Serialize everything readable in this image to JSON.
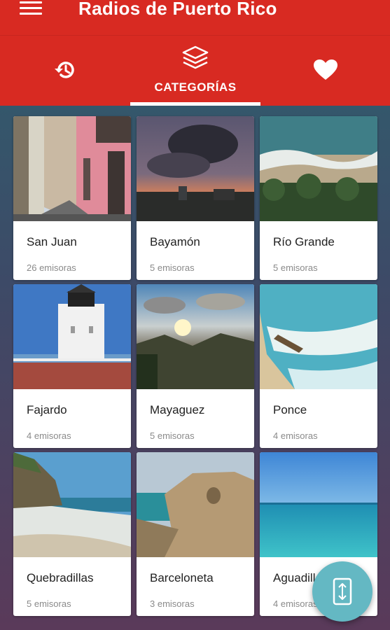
{
  "app": {
    "title": "Radios de Puerto Rico"
  },
  "tabs": [
    {
      "icon": "history-icon",
      "label": ""
    },
    {
      "icon": "layers-icon",
      "label": "CATEGORÍAS",
      "selected": true
    },
    {
      "icon": "heart-icon",
      "label": ""
    }
  ],
  "categories": [
    {
      "name": "San Juan",
      "count": "26 emisoras"
    },
    {
      "name": "Bayamón",
      "count": "5 emisoras"
    },
    {
      "name": "Río Grande",
      "count": "5 emisoras"
    },
    {
      "name": "Fajardo",
      "count": "4 emisoras"
    },
    {
      "name": "Mayaguez",
      "count": "5 emisoras"
    },
    {
      "name": "Ponce",
      "count": "4 emisoras"
    },
    {
      "name": "Quebradillas",
      "count": "5 emisoras"
    },
    {
      "name": "Barceloneta",
      "count": "3 emisoras"
    },
    {
      "name": "Aguadilla",
      "count": "4 emisoras"
    }
  ],
  "fab": {
    "icon": "swap-vertical-icon"
  },
  "colors": {
    "appbar": "#d82a22",
    "fab": "#64b8c3"
  }
}
